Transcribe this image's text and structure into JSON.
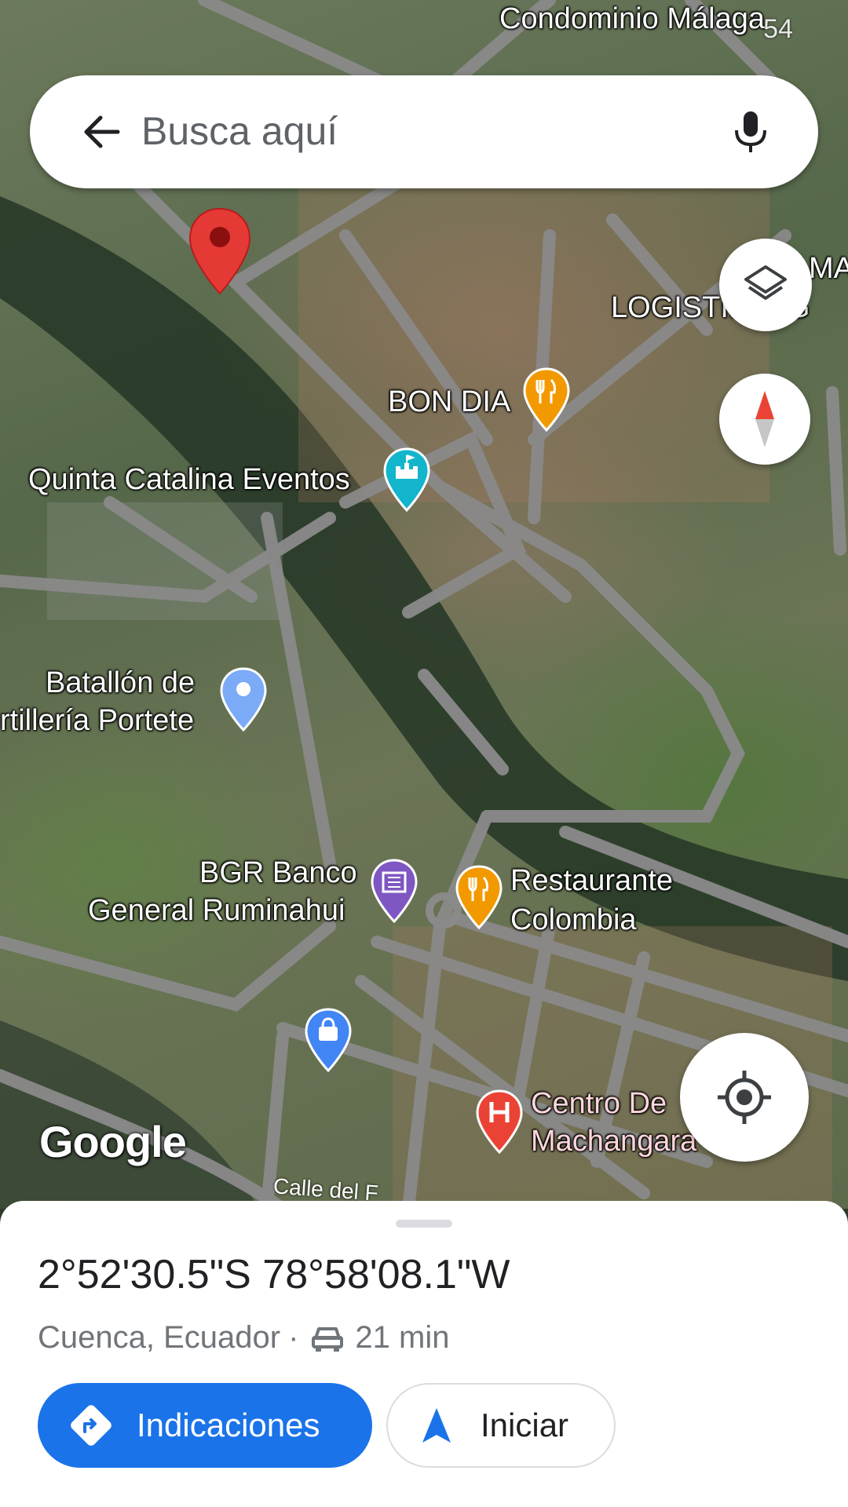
{
  "status_bar": {
    "right_text": "54"
  },
  "search": {
    "placeholder": "Busca aquí"
  },
  "map": {
    "labels": {
      "condominio": "Condominio Málaga",
      "logistica": "LOGISTI... 3 G",
      "logistica_top": "MA",
      "bon_dia": "BON DIA",
      "quinta": "Quinta Catalina Eventos",
      "batallon_1": "Batallón de",
      "batallon_2": "rtillería Portete",
      "bgr_1": "BGR Banco",
      "bgr_2": "General Ruminahui",
      "rest_1": "Restaurante",
      "rest_2": "Colombia",
      "centro_1": "Centro De",
      "centro_2": "Machangara",
      "road": "Calle del F"
    },
    "google_logo": "Google",
    "pin_colors": {
      "dropped": "#e53935",
      "restaurant": "#f29900",
      "venue": "#12b5cb",
      "landmark": "#7baaf7",
      "bank": "#7e57c2",
      "shopping": "#4285f4",
      "hospital": "#ea4335"
    }
  },
  "sheet": {
    "coordinates": "2°52'30.5\"S 78°58'08.1\"W",
    "location": "Cuenca, Ecuador",
    "separator": "·",
    "drive_time": "21 min",
    "directions_label": "Indicaciones",
    "start_label": "Iniciar"
  },
  "colors": {
    "accent": "#1a73e8"
  }
}
